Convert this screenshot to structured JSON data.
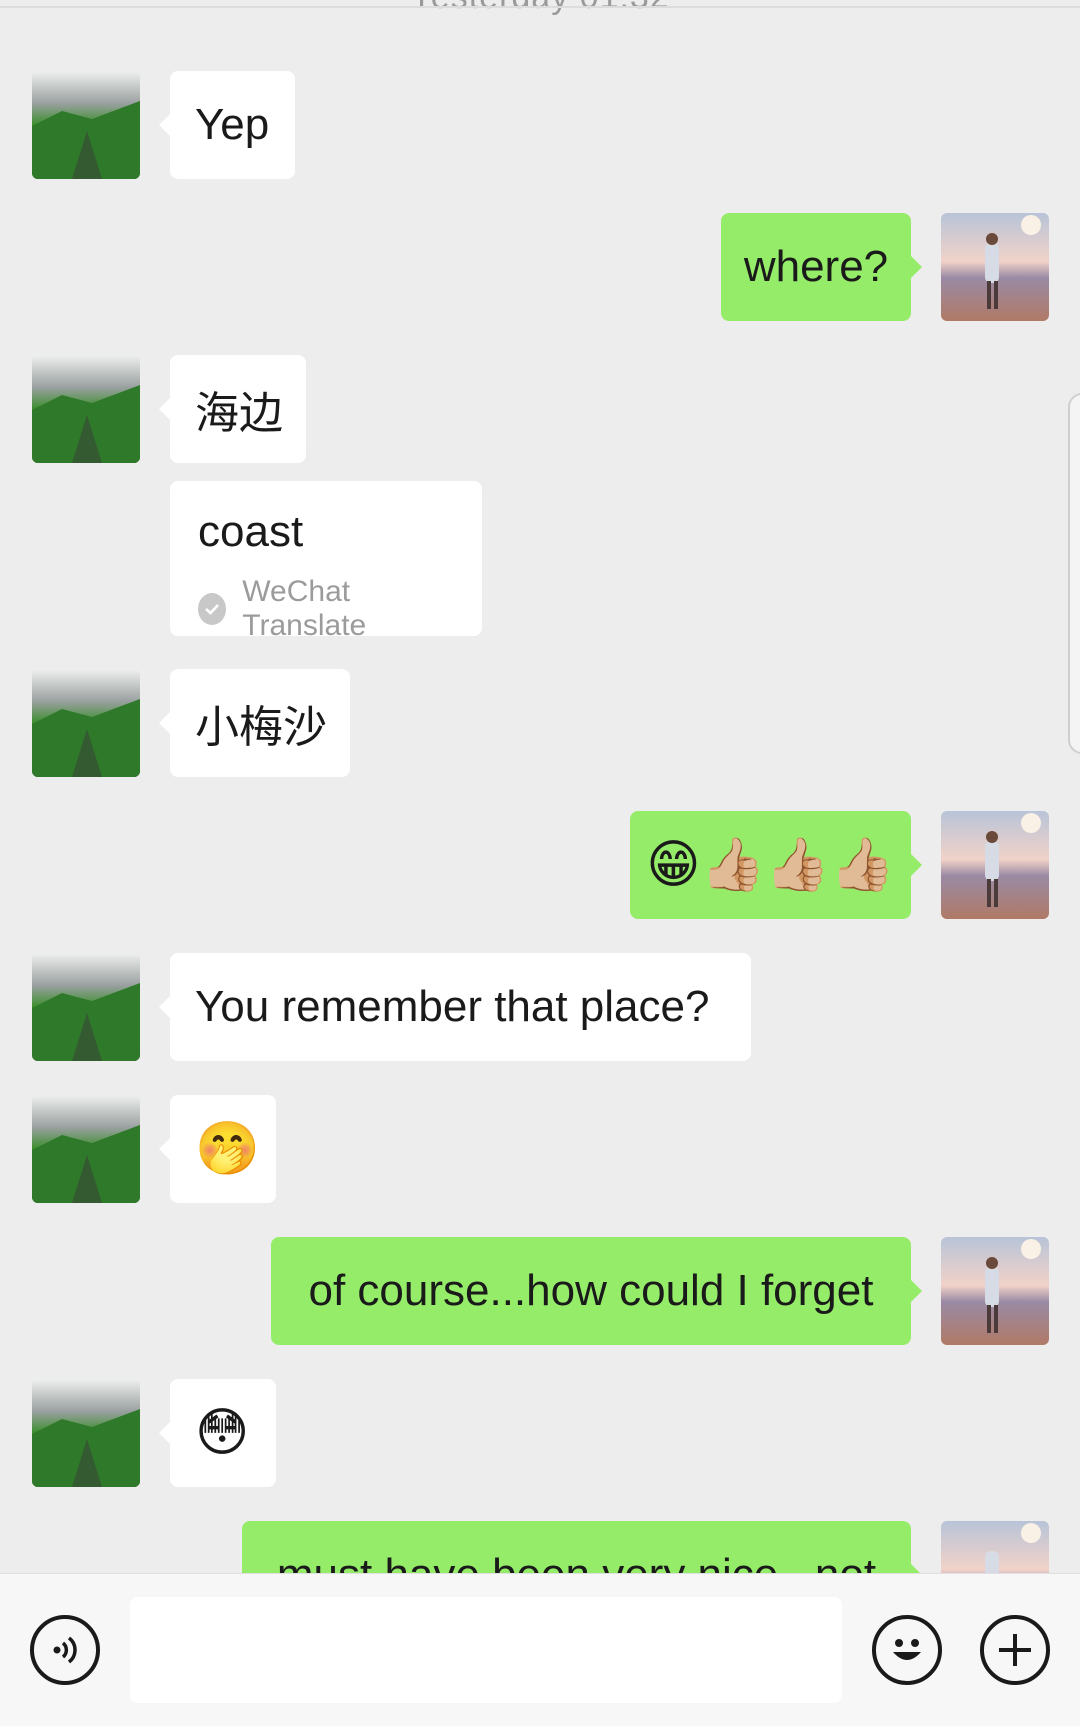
{
  "header": {
    "timestamp": "Yesterday 01:32"
  },
  "messages": [
    {
      "side": "in",
      "text": "Yep"
    },
    {
      "side": "out",
      "text": "where?"
    },
    {
      "side": "in",
      "text": "海边"
    },
    {
      "side": "in",
      "text": "coast",
      "translate_label": "WeChat Translate"
    },
    {
      "side": "in",
      "text": "小梅沙"
    },
    {
      "side": "out",
      "text": "😁👍🏼👍🏼👍🏼"
    },
    {
      "side": "in",
      "text": "You remember that place?"
    },
    {
      "side": "in",
      "text": "🤭"
    },
    {
      "side": "out",
      "text": "of course...how could I forget"
    },
    {
      "side": "in",
      "text": "😳"
    },
    {
      "side": "out",
      "text": "must have been very nice...not"
    }
  ],
  "input": {
    "placeholder": ""
  },
  "icons": {
    "voice": "voice-icon",
    "emoji": "emoji-icon",
    "more": "plus-icon"
  },
  "colors": {
    "background": "#ededed",
    "bubble_out": "#95ec69",
    "bubble_in": "#ffffff"
  }
}
